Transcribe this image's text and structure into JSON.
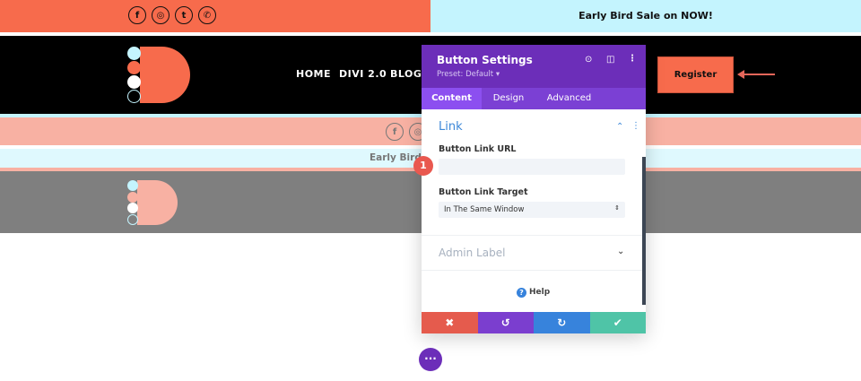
{
  "topbar": {
    "sale_text": "Early Bird Sale on NOW!",
    "social": [
      "facebook-icon",
      "instagram-icon",
      "twitter-icon",
      "whatsapp-icon"
    ]
  },
  "nav": {
    "items": [
      "HOME",
      "DIVI 2.0",
      "BLOG"
    ],
    "register_label": "Register"
  },
  "preview": {
    "sale_text": "Early Bird"
  },
  "panel": {
    "title": "Button Settings",
    "preset": "Preset: Default ▾",
    "tabs": [
      "Content",
      "Design",
      "Advanced"
    ],
    "section_link": "Link",
    "url_label": "Button Link URL",
    "url_value": "",
    "target_label": "Button Link Target",
    "target_value": "In The Same Window",
    "admin_label": "Admin Label",
    "help": "Help",
    "step_badge": "1"
  },
  "colors": {
    "orange": "#f76b4c",
    "purple": "#6c2eb9",
    "red": "#e55b4d",
    "blue": "#3783dc",
    "green": "#4fc4a7"
  }
}
